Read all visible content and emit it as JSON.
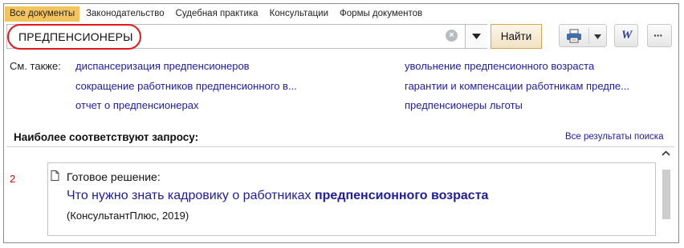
{
  "tabs": [
    {
      "label": "Все документы",
      "active": true
    },
    {
      "label": "Законодательство",
      "active": false
    },
    {
      "label": "Судебная практика",
      "active": false
    },
    {
      "label": "Консультации",
      "active": false
    },
    {
      "label": "Формы документов",
      "active": false
    }
  ],
  "search": {
    "value": "ПРЕДПЕНСИОНЕРЫ",
    "clear_icon": "clear-circle-x",
    "dropdown_icon": "triangle-down",
    "find_label": "Найти"
  },
  "toolbar": {
    "print_icon": "printer",
    "word_icon": "word-w",
    "word_glyph": "W",
    "more_icon": "ellipsis",
    "more_glyph": "···"
  },
  "see_also": {
    "label": "См. также:",
    "left_links": [
      "диспансеризация предпенсионеров",
      "сокращение работников предпенсионного в...",
      "отчет о предпенсионерах"
    ],
    "right_links": [
      "увольнение предпенсионного возраста",
      "гарантии и компенсации работникам предпе...",
      "предпенсионеры льготы"
    ]
  },
  "results": {
    "title": "Наиболее соответствуют запросу:",
    "all_link": "Все результаты поиска",
    "items": [
      {
        "number": "2",
        "type": "Готовое решение:",
        "title_plain": "Что нужно знать кадровику о работниках ",
        "title_bold": "предпенсионного возраста",
        "source": "(КонсультантПлюс, 2019)"
      }
    ]
  },
  "colors": {
    "active_tab": "#f3c35e",
    "link": "#1f1ca0",
    "highlight_oval": "#e3171b",
    "result_number": "#e00000"
  }
}
